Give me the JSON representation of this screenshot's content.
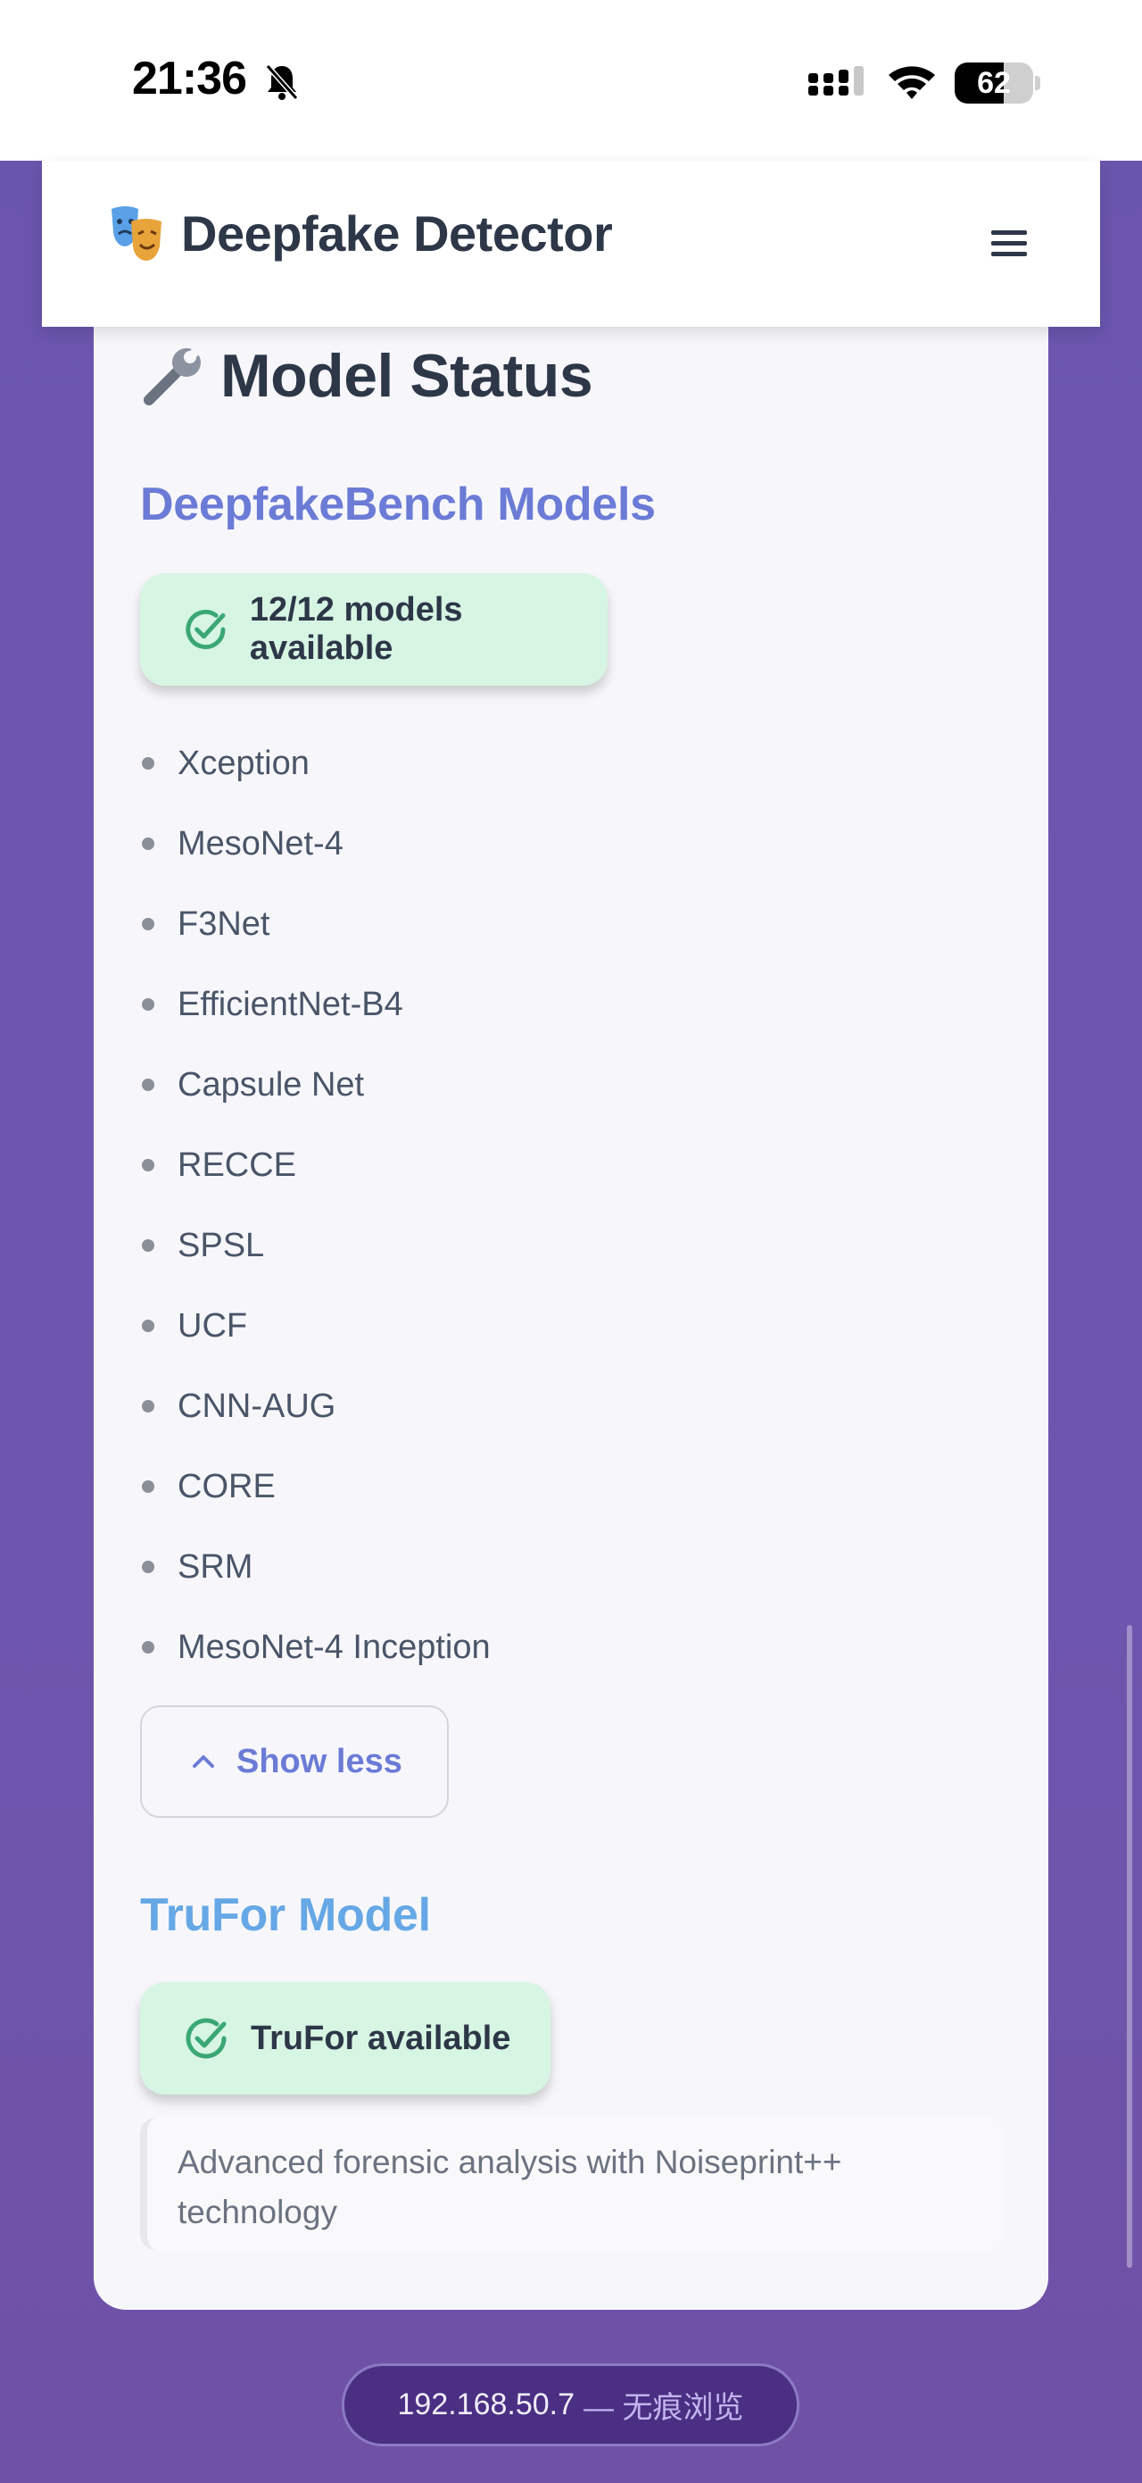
{
  "status_bar": {
    "time": "21:36",
    "battery_level": "62",
    "battery_fraction": 0.62,
    "icons": [
      "bell-slash-icon",
      "signal-icon",
      "wifi-icon",
      "battery-icon"
    ]
  },
  "header": {
    "brand_icon": "theater-masks-icon",
    "title": "Deepfake Detector",
    "menu_icon": "hamburger-menu-icon"
  },
  "model_status": {
    "title_icon": "wrench-icon",
    "title": "Model Status",
    "deepfakebench": {
      "heading": "DeepfakeBench Models",
      "badge_text": "12/12 models available",
      "models": [
        "Xception",
        "MesoNet-4",
        "F3Net",
        "EfficientNet-B4",
        "Capsule Net",
        "RECCE",
        "SPSL",
        "UCF",
        "CNN-AUG",
        "CORE",
        "SRM",
        "MesoNet-4 Inception"
      ],
      "toggle_label": "Show less"
    },
    "trufor": {
      "heading": "TruFor Model",
      "badge_text": "TruFor available",
      "description": "Advanced forensic analysis with Noiseprint++ technology"
    }
  },
  "browser": {
    "url_host": "192.168.50.7",
    "url_mode": "— 无痕浏览"
  },
  "colors": {
    "background": "#6e56b0",
    "accent_heading": "#6b7bd6",
    "trufor_heading": "#66a8e6",
    "success_badge": "#d7f5e3",
    "success_icon": "#3aa774"
  }
}
